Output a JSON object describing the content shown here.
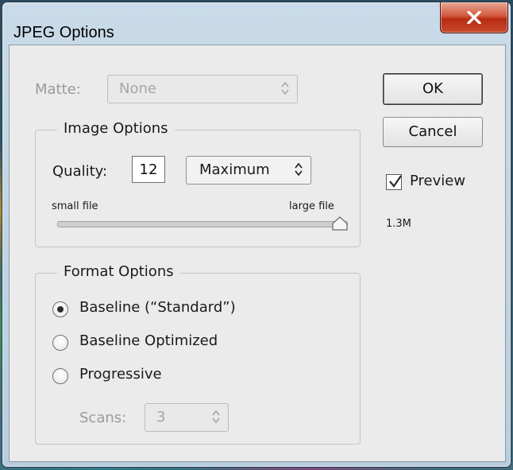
{
  "window": {
    "title": "JPEG Options",
    "close_label": "x"
  },
  "matte": {
    "label": "Matte:",
    "value": "None"
  },
  "buttons": {
    "ok": "OK",
    "cancel": "Cancel"
  },
  "preview": {
    "label": "Preview",
    "checked": true,
    "file_size": "1.3M"
  },
  "image_options": {
    "legend": "Image Options",
    "quality_label": "Quality:",
    "quality_value": "12",
    "quality_preset": "Maximum",
    "slider_min_label": "small file",
    "slider_max_label": "large file",
    "slider_level": 1.0
  },
  "format_options": {
    "legend": "Format Options",
    "options": [
      {
        "label": "Baseline (“Standard”)",
        "selected": true
      },
      {
        "label": "Baseline Optimized",
        "selected": false
      },
      {
        "label": "Progressive",
        "selected": false
      }
    ],
    "scans_label": "Scans:",
    "scans_value": "3"
  },
  "icons": {
    "close": "close-icon",
    "select_arrow": "updown-arrows-icon",
    "check": "checkmark-icon"
  },
  "colors": {
    "close_button": "#c94a2c",
    "dialog_bg": "#ebebeb",
    "title_bar": "#c9dbe9"
  }
}
